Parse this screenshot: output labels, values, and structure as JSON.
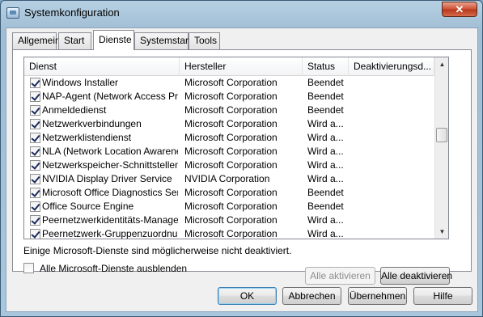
{
  "window": {
    "title": "Systemkonfiguration",
    "close_glyph": "✕"
  },
  "tabs": [
    {
      "label": "Allgemein",
      "active": false
    },
    {
      "label": "Start",
      "active": false
    },
    {
      "label": "Dienste",
      "active": true
    },
    {
      "label": "Systemstart",
      "active": false
    },
    {
      "label": "Tools",
      "active": false
    }
  ],
  "services": {
    "columns": [
      "Dienst",
      "Hersteller",
      "Status",
      "Deaktivierungsd..."
    ],
    "rows": [
      {
        "name": "Windows Installer",
        "vendor": "Microsoft Corporation",
        "status": "Beendet",
        "checked": true
      },
      {
        "name": "NAP-Agent (Network Access Pro...",
        "vendor": "Microsoft Corporation",
        "status": "Beendet",
        "checked": true
      },
      {
        "name": "Anmeldedienst",
        "vendor": "Microsoft Corporation",
        "status": "Beendet",
        "checked": true
      },
      {
        "name": "Netzwerkverbindungen",
        "vendor": "Microsoft Corporation",
        "status": "Wird a...",
        "checked": true
      },
      {
        "name": "Netzwerklistendienst",
        "vendor": "Microsoft Corporation",
        "status": "Wird a...",
        "checked": true
      },
      {
        "name": "NLA (Network Location Awarene...",
        "vendor": "Microsoft Corporation",
        "status": "Wird a...",
        "checked": true
      },
      {
        "name": "Netzwerkspeicher-Schnittstellen...",
        "vendor": "Microsoft Corporation",
        "status": "Wird a...",
        "checked": true
      },
      {
        "name": "NVIDIA Display Driver Service",
        "vendor": "NVIDIA Corporation",
        "status": "Wird a...",
        "checked": true
      },
      {
        "name": "Microsoft Office Diagnostics Ser...",
        "vendor": "Microsoft Corporation",
        "status": "Beendet",
        "checked": true
      },
      {
        "name": "Office Source Engine",
        "vendor": "Microsoft Corporation",
        "status": "Beendet",
        "checked": true
      },
      {
        "name": "Peernetzwerkidentitäts-Manager",
        "vendor": "Microsoft Corporation",
        "status": "Wird a...",
        "checked": true
      },
      {
        "name": "Peernetzwerk-Gruppenzuordnung",
        "vendor": "Microsoft Corporation",
        "status": "Wird a...",
        "checked": true
      }
    ],
    "scroll_up_glyph": "▲",
    "scroll_down_glyph": "▼"
  },
  "note": "Einige Microsoft-Dienste sind möglicherweise nicht deaktiviert.",
  "buttons": {
    "enable_all": "Alle aktivieren",
    "disable_all": "Alle deaktivieren",
    "ok": "OK",
    "cancel": "Abbrechen",
    "apply": "Übernehmen",
    "help": "Hilfe"
  },
  "hide_ms": {
    "label": "Alle Microsoft-Dienste ausblenden",
    "checked": false
  }
}
